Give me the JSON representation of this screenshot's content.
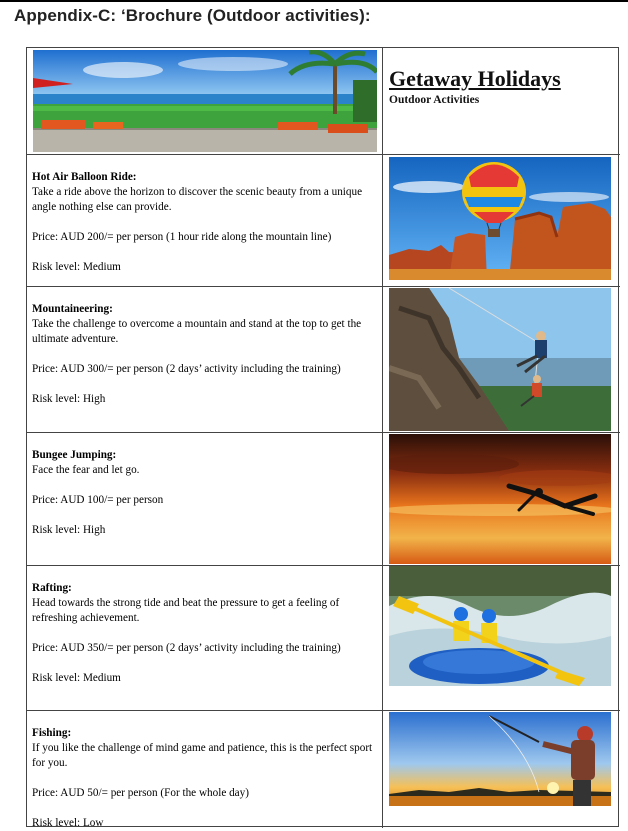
{
  "heading": "Appendix-C: ‘Brochure (Outdoor activities):",
  "brand": {
    "title": "Getaway Holidays",
    "subtitle": "Outdoor Activities"
  },
  "activities": [
    {
      "title": "Hot Air Balloon Ride:",
      "description": "Take a ride above the horizon to discover the scenic beauty from a unique angle nothing else can provide.",
      "price": "Price: AUD 200/= per person (1 hour ride along the mountain line)",
      "risk": "Risk level: Medium",
      "image": "hot-air-balloon-canyon-photo"
    },
    {
      "title": "Mountaineering:",
      "description": "Take the challenge to overcome a mountain and stand at the top to get the ultimate adventure.",
      "price": "Price: AUD 300/= per person (2 days’ activity including the training)",
      "risk": "Risk level: High",
      "image": "rock-climbers-rappelling-photo"
    },
    {
      "title": "Bungee Jumping:",
      "description": "Face the fear and let go.",
      "price": "Price: AUD 100/= per person",
      "risk": "Risk level: High",
      "image": "bungee-jumper-sunset-photo"
    },
    {
      "title": "Rafting:",
      "description": "Head towards the strong tide and beat the pressure to get a feeling of refreshing achievement.",
      "price": "Price: AUD 350/= per person (2 days’ activity including the training)",
      "risk": "Risk level: Medium",
      "image": "whitewater-rafting-photo"
    },
    {
      "title": "Fishing:",
      "description": "If you like the challenge of mind game and patience, this is the perfect sport for you.",
      "price": "Price: AUD 50/= per person (For the whole day)",
      "risk": "Risk level: Low",
      "image": "fisherman-sunset-photo"
    }
  ],
  "header_image": "beach-resort-lawn-photo",
  "colors": {
    "border": "#444444",
    "sky_blue": "#3a8fd9",
    "sunset_orange": "#e8741c"
  }
}
